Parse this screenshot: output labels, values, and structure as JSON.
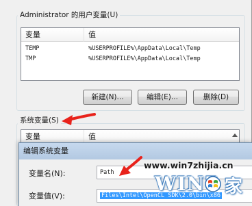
{
  "user_vars": {
    "group_label": "Administrator 的用户变量(U)",
    "col_variable": "变量",
    "col_value": "值",
    "rows": [
      {
        "name": "TEMP",
        "value": "%USERPROFILE%\\AppData\\Local\\Temp"
      },
      {
        "name": "TMP",
        "value": "%USERPROFILE%\\AppData\\Local\\Temp"
      }
    ],
    "btn_new": "新建(N)...",
    "btn_edit": "编辑(E)...",
    "btn_delete": "删除(D)"
  },
  "sys_vars": {
    "group_label": "系统变量(S)",
    "col_variable": "变量",
    "col_value": "值"
  },
  "edit_dialog": {
    "title": "编辑系统变量",
    "name_label": "变量名(N):",
    "name_value": "Path",
    "value_label": "变量值(V):",
    "value_value": "Files\\Intel\\OpenCL SDK\\2.0\\bin\\x86"
  },
  "watermark": {
    "url": "www.win7zhijia.cn",
    "logo_text": "WIN7",
    "logo_suffix": "家"
  },
  "colors": {
    "annotation_arrow": "#e8221b",
    "selection": "#3399ff"
  },
  "icons": [
    "red-arrow-annotation",
    "windows-flag-icon",
    "scroll-up-icon"
  ]
}
